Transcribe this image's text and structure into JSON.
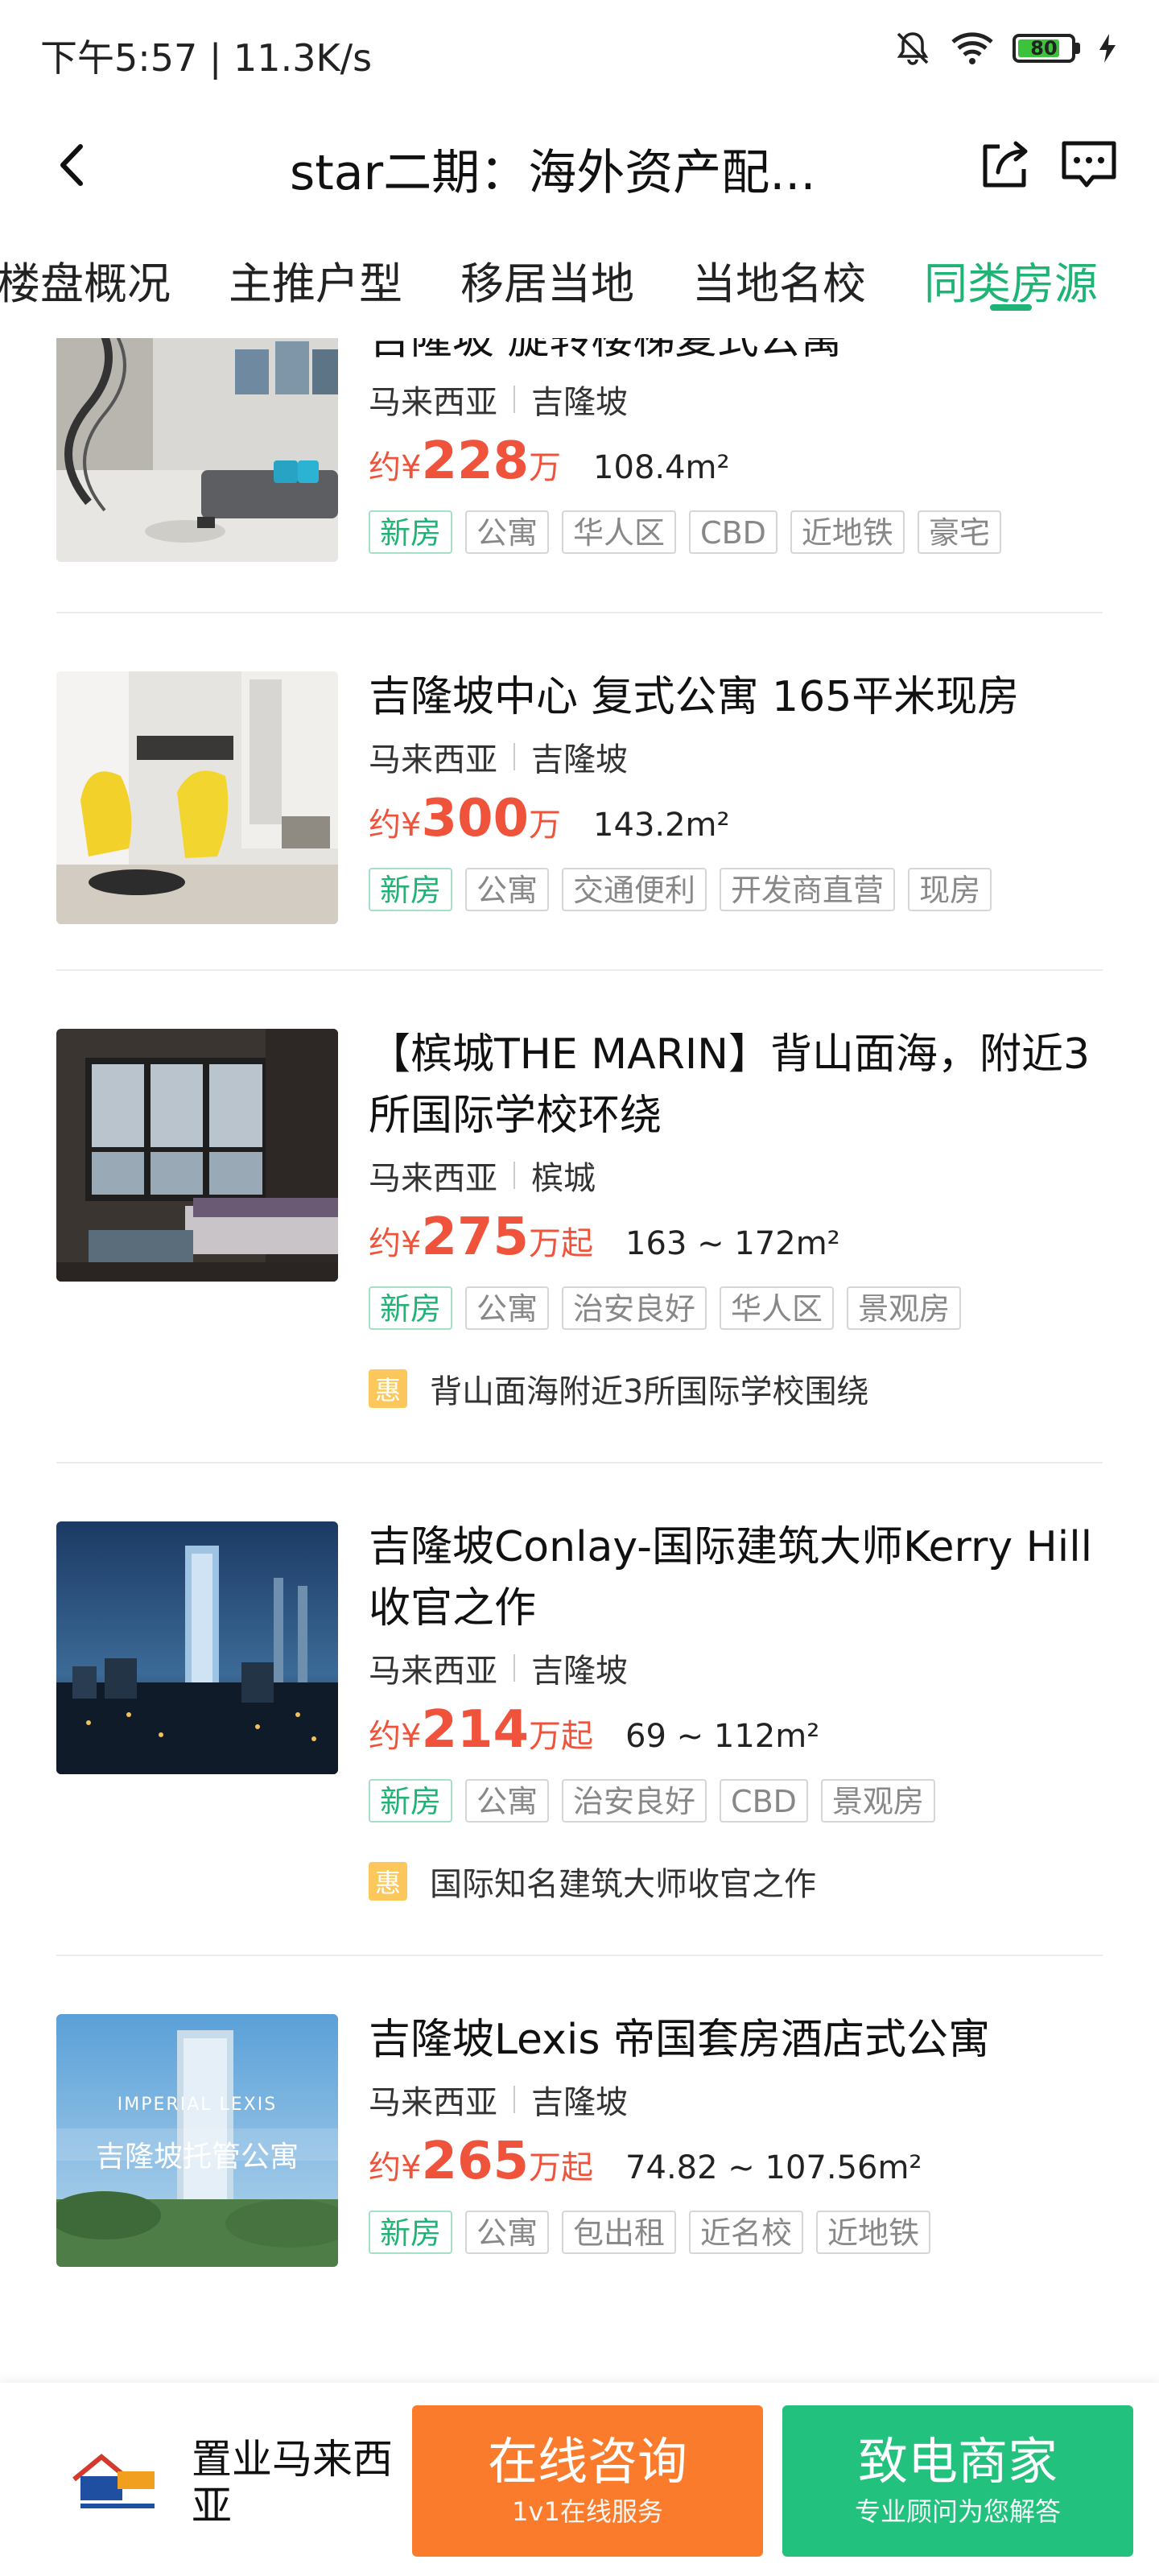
{
  "status_bar": {
    "time_speed": "下午5:57 | 11.3K/s",
    "battery": "80",
    "battery_level": 0.8,
    "icons": [
      "mute-bell-icon",
      "wifi-icon",
      "battery-icon",
      "charging-icon"
    ]
  },
  "nav": {
    "title": "star二期：海外资产配...",
    "back_icon": "chevron-left-icon",
    "share_icon": "share-icon",
    "message_icon": "message-icon"
  },
  "tabs": [
    {
      "label": "楼盘概况",
      "active": false
    },
    {
      "label": "主推户型",
      "active": false
    },
    {
      "label": "移居当地",
      "active": false
    },
    {
      "label": "当地名校",
      "active": false
    },
    {
      "label": "同类房源",
      "active": true
    }
  ],
  "listings": [
    {
      "title": "吉隆坡 旋转楼梯复式公寓",
      "country": "马来西亚",
      "city": "吉隆坡",
      "price_prefix": "约¥",
      "price": "228",
      "price_unit": "万",
      "area": "108.4m²",
      "tags": [
        "新房",
        "公寓",
        "华人区",
        "CBD",
        "近地铁",
        "豪宅"
      ],
      "promo": ""
    },
    {
      "title": "吉隆坡中心 复式公寓 165平米现房",
      "country": "马来西亚",
      "city": "吉隆坡",
      "price_prefix": "约¥",
      "price": "300",
      "price_unit": "万",
      "area": "143.2m²",
      "tags": [
        "新房",
        "公寓",
        "交通便利",
        "开发商直营",
        "现房"
      ],
      "promo": ""
    },
    {
      "title": "【槟城THE MARIN】背山面海，附近3所国际学校环绕",
      "country": "马来西亚",
      "city": "槟城",
      "price_prefix": "约¥",
      "price": "275",
      "price_unit": "万起",
      "area": "163 ~ 172m²",
      "tags": [
        "新房",
        "公寓",
        "治安良好",
        "华人区",
        "景观房"
      ],
      "promo_badge": "惠",
      "promo": "背山面海附近3所国际学校围绕"
    },
    {
      "title": "吉隆坡Conlay-国际建筑大师Kerry Hill收官之作",
      "country": "马来西亚",
      "city": "吉隆坡",
      "price_prefix": "约¥",
      "price": "214",
      "price_unit": "万起",
      "area": "69 ~ 112m²",
      "tags": [
        "新房",
        "公寓",
        "治安良好",
        "CBD",
        "景观房"
      ],
      "promo_badge": "惠",
      "promo": "国际知名建筑大师收官之作"
    },
    {
      "title": "吉隆坡Lexis 帝国套房酒店式公寓",
      "country": "马来西亚",
      "city": "吉隆坡",
      "price_prefix": "约¥",
      "price": "265",
      "price_unit": "万起",
      "area": "74.82 ~ 107.56m²",
      "tags": [
        "新房",
        "公寓",
        "包出租",
        "近名校",
        "近地铁"
      ],
      "promo": "",
      "image_caption": "吉隆坡托管公寓",
      "image_brand": "IMPERIAL LEXIS"
    }
  ],
  "bottom_bar": {
    "agent_name": "置业马来西亚",
    "consult_label": "在线咨询",
    "consult_sub": "1v1在线服务",
    "call_label": "致电商家",
    "call_sub": "专业顾问为您解答"
  },
  "colors": {
    "accent_green": "#1fb476",
    "price_red": "#f0533b",
    "consult_orange": "#fb7b2d",
    "call_green": "#23c17e",
    "promo_yellow": "#fcc85b"
  }
}
